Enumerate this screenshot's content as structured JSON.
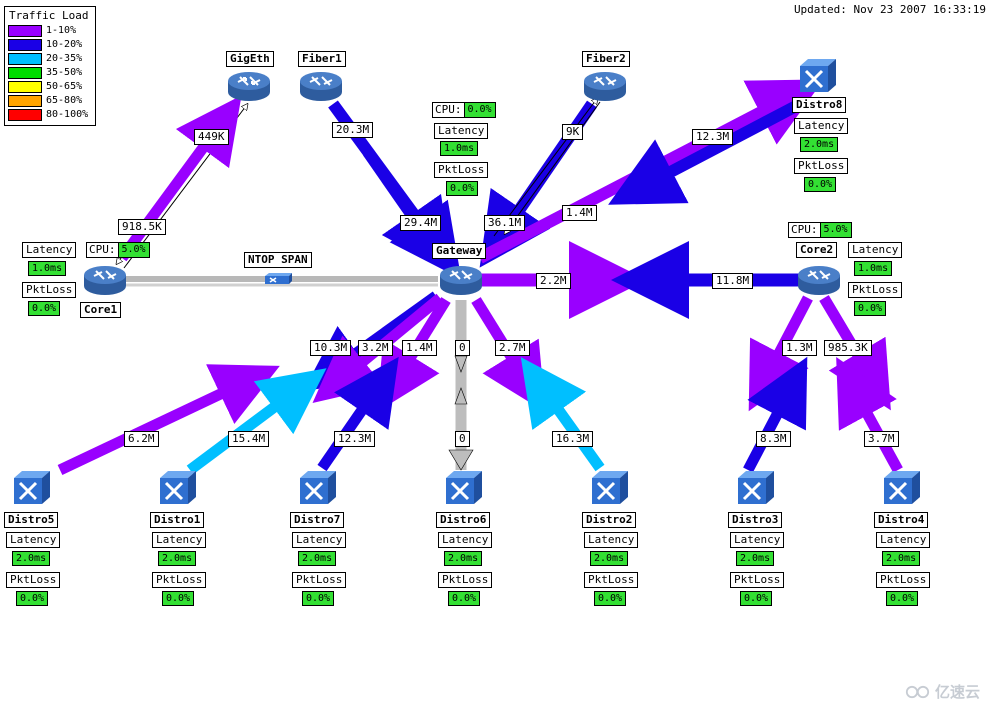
{
  "header": {
    "updated": "Updated: Nov 23 2007 16:33:19"
  },
  "legend": {
    "title": "Traffic Load",
    "items": [
      {
        "label": "1-10%",
        "color": "#9900ff"
      },
      {
        "label": "10-20%",
        "color": "#1a00e6"
      },
      {
        "label": "20-35%",
        "color": "#00bfff"
      },
      {
        "label": "35-50%",
        "color": "#00dd00"
      },
      {
        "label": "50-65%",
        "color": "#ffff00"
      },
      {
        "label": "65-80%",
        "color": "#ffa500"
      },
      {
        "label": "80-100%",
        "color": "#ff0000"
      }
    ]
  },
  "colors": {
    "purple": "#9900ff",
    "blue": "#1a00e6",
    "cyan": "#00bfff",
    "green": "#33e033",
    "gray": "#bdbdbd",
    "white_link": "#ffffff"
  },
  "nodes": {
    "gigeth": {
      "label": "GigEth",
      "type": "router"
    },
    "fiber1": {
      "label": "Fiber1",
      "type": "router"
    },
    "fiber2": {
      "label": "Fiber2",
      "type": "router"
    },
    "gateway": {
      "label": "Gateway",
      "type": "router",
      "cpu_key": "CPU:",
      "cpu": "0.0%",
      "latency_key": "Latency",
      "latency": "1.0ms",
      "pktloss_key": "PktLoss",
      "pktloss": "0.0%"
    },
    "core1": {
      "label": "Core1",
      "type": "router",
      "cpu_key": "CPU:",
      "cpu": "5.0%",
      "latency_key": "Latency",
      "latency": "1.0ms",
      "pktloss_key": "PktLoss",
      "pktloss": "0.0%"
    },
    "core2": {
      "label": "Core2",
      "type": "router",
      "cpu_key": "CPU:",
      "cpu": "5.0%",
      "latency_key": "Latency",
      "latency": "1.0ms",
      "pktloss_key": "PktLoss",
      "pktloss": "0.0%"
    },
    "ntop": {
      "label": "NTOP SPAN",
      "type": "mini-switch"
    },
    "distro8": {
      "label": "Distro8",
      "type": "switch",
      "latency_key": "Latency",
      "latency": "2.0ms",
      "pktloss_key": "PktLoss",
      "pktloss": "0.0%"
    },
    "distro5": {
      "label": "Distro5",
      "type": "switch",
      "latency_key": "Latency",
      "latency": "2.0ms",
      "pktloss_key": "PktLoss",
      "pktloss": "0.0%"
    },
    "distro1": {
      "label": "Distro1",
      "type": "switch",
      "latency_key": "Latency",
      "latency": "2.0ms",
      "pktloss_key": "PktLoss",
      "pktloss": "0.0%"
    },
    "distro7": {
      "label": "Distro7",
      "type": "switch",
      "latency_key": "Latency",
      "latency": "2.0ms",
      "pktloss_key": "PktLoss",
      "pktloss": "0.0%"
    },
    "distro6": {
      "label": "Distro6",
      "type": "switch",
      "latency_key": "Latency",
      "latency": "2.0ms",
      "pktloss_key": "PktLoss",
      "pktloss": "0.0%"
    },
    "distro2": {
      "label": "Distro2",
      "type": "switch",
      "latency_key": "Latency",
      "latency": "2.0ms",
      "pktloss_key": "PktLoss",
      "pktloss": "0.0%"
    },
    "distro3": {
      "label": "Distro3",
      "type": "switch",
      "latency_key": "Latency",
      "latency": "2.0ms",
      "pktloss_key": "PktLoss",
      "pktloss": "0.0%"
    },
    "distro4": {
      "label": "Distro4",
      "type": "switch",
      "latency_key": "Latency",
      "latency": "2.0ms",
      "pktloss_key": "PktLoss",
      "pktloss": "0.0%"
    }
  },
  "links": [
    {
      "id": "gigeth-core1-down",
      "from": "GigEth",
      "to": "Core1",
      "label": "449K",
      "color": "#ffffff"
    },
    {
      "id": "core1-gigeth-up",
      "from": "Core1",
      "to": "GigEth",
      "label": "918.5K",
      "color": "#9900ff"
    },
    {
      "id": "fiber1-gateway",
      "from": "Fiber1",
      "to": "Gateway",
      "label": "20.3M",
      "color": "#1a00e6"
    },
    {
      "id": "fiber1-gateway-in",
      "from": "Fiber1",
      "to": "Gateway",
      "label": "29.4M",
      "color": "#1a00e6"
    },
    {
      "id": "fiber2-gateway-in",
      "from": "Fiber2",
      "to": "Gateway",
      "label": "36.1M",
      "color": "#1a00e6"
    },
    {
      "id": "fiber2-gateway-out",
      "from": "Gateway",
      "to": "Fiber2",
      "label": "9K",
      "color": "#ffffff"
    },
    {
      "id": "gateway-distro8",
      "from": "Gateway",
      "to": "Distro8",
      "label": "1.4M",
      "color": "#9900ff"
    },
    {
      "id": "distro8-gateway",
      "from": "Distro8",
      "to": "Gateway",
      "label": "12.3M",
      "color": "#1a00e6"
    },
    {
      "id": "gateway-core2",
      "from": "Gateway",
      "to": "Core2",
      "label": "2.2M",
      "color": "#9900ff"
    },
    {
      "id": "core2-gateway",
      "from": "Core2",
      "to": "Gateway",
      "label": "11.8M",
      "color": "#1a00e6"
    },
    {
      "id": "gateway-distro5",
      "from": "Gateway",
      "to": "Distro5",
      "label": "10.3M",
      "color": "#1a00e6"
    },
    {
      "id": "distro5-gateway",
      "from": "Distro5",
      "to": "Gateway",
      "label": "6.2M",
      "color": "#9900ff"
    },
    {
      "id": "gateway-distro1",
      "from": "Gateway",
      "to": "Distro1",
      "label": "3.2M",
      "color": "#9900ff"
    },
    {
      "id": "distro1-gateway",
      "from": "Distro1",
      "to": "Gateway",
      "label": "15.4M",
      "color": "#00bfff"
    },
    {
      "id": "gateway-distro7",
      "from": "Gateway",
      "to": "Distro7",
      "label": "1.4M",
      "color": "#9900ff"
    },
    {
      "id": "distro7-gateway",
      "from": "Distro7",
      "to": "Gateway",
      "label": "12.3M",
      "color": "#1a00e6"
    },
    {
      "id": "gateway-distro6",
      "from": "Gateway",
      "to": "Distro6",
      "label": "0",
      "color": "#bdbdbd"
    },
    {
      "id": "distro6-gateway",
      "from": "Distro6",
      "to": "Gateway",
      "label": "0",
      "color": "#bdbdbd"
    },
    {
      "id": "gateway-distro2",
      "from": "Gateway",
      "to": "Distro2",
      "label": "2.7M",
      "color": "#9900ff"
    },
    {
      "id": "distro2-gateway",
      "from": "Distro2",
      "to": "Gateway",
      "label": "16.3M",
      "color": "#00bfff"
    },
    {
      "id": "core2-distro3",
      "from": "Core2",
      "to": "Distro3",
      "label": "1.3M",
      "color": "#9900ff"
    },
    {
      "id": "distro3-core2",
      "from": "Distro3",
      "to": "Core2",
      "label": "8.3M",
      "color": "#1a00e6"
    },
    {
      "id": "core2-distro4",
      "from": "Core2",
      "to": "Distro4",
      "label": "985.3K",
      "color": "#9900ff"
    },
    {
      "id": "distro4-core2",
      "from": "Distro4",
      "to": "Core2",
      "label": "3.7M",
      "color": "#9900ff"
    }
  ],
  "watermark": {
    "text": "亿速云"
  }
}
